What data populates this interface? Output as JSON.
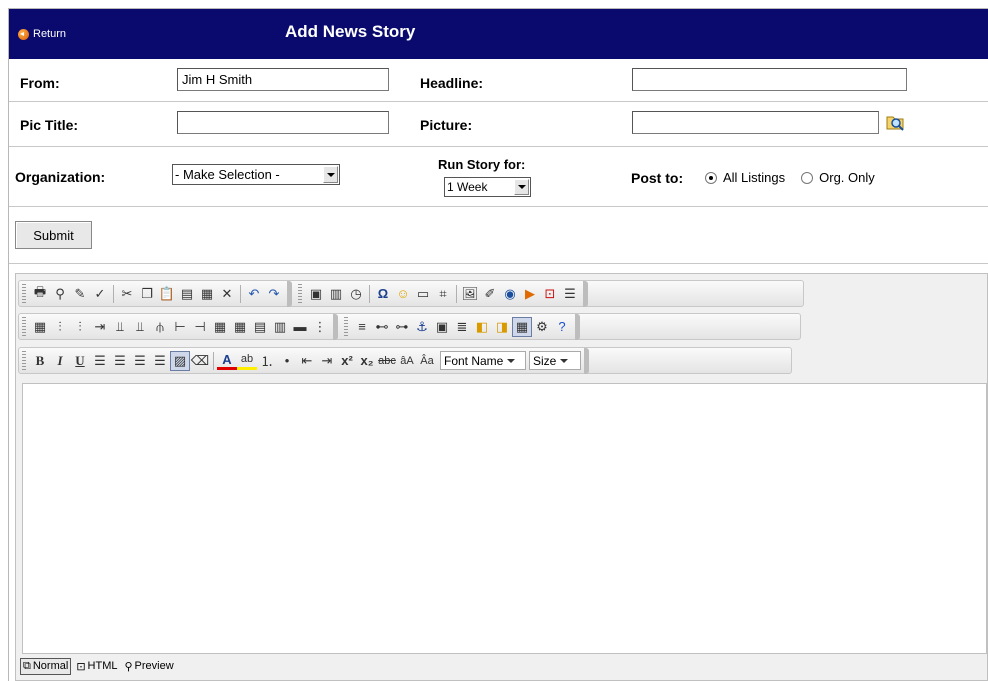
{
  "header": {
    "return_label": "Return",
    "title": "Add News Story",
    "background_color": "#0a0a6e"
  },
  "form": {
    "from_label": "From:",
    "from_value": "Jim H Smith",
    "headline_label": "Headline:",
    "headline_value": "",
    "pic_title_label": "Pic Title:",
    "pic_title_value": "",
    "picture_label": "Picture:",
    "picture_value": "",
    "picture_browse_icon": "folder-search-icon",
    "organization_label": "Organization:",
    "organization_selected": "- Make Selection -",
    "run_story_label": "Run Story for:",
    "run_story_selected": "1 Week",
    "post_to_label": "Post to:",
    "post_to_options": [
      {
        "label": "All Listings",
        "selected": true
      },
      {
        "label": "Org. Only",
        "selected": false
      }
    ],
    "submit_label": "Submit"
  },
  "editor": {
    "toolbar1": [
      "print-icon",
      "find-icon",
      "clean-icon",
      "spellcheck-icon",
      "|",
      "cut-icon",
      "copy-icon",
      "paste-icon",
      "paste-text-icon",
      "paste-word-icon",
      "delete-icon",
      "|",
      "undo-icon",
      "redo-icon",
      "||",
      "insert-template-icon",
      "insert-form-icon",
      "insert-time-icon",
      "|",
      "special-char-icon",
      "emoticon-icon",
      "insert-box-icon",
      "insert-snippet-icon",
      "|",
      "insert-image-icon",
      "image-editor-icon",
      "flash-icon",
      "media-icon",
      "pdf-icon",
      "insert-document-icon"
    ],
    "toolbar2": [
      "insert-table-icon",
      "insert-column-left-icon",
      "insert-column-right-icon",
      "delete-column-icon",
      "insert-row-above-icon",
      "insert-row-below-icon",
      "delete-row-icon",
      "split-cell-icon",
      "merge-cell-icon",
      "table-properties-icon",
      "cell-properties-icon",
      "table-border-icon",
      "table-style-icon",
      "merge-right-icon",
      "merge-down-icon",
      "||",
      "horizontal-rule-icon",
      "insert-link-icon",
      "unlink-icon",
      "anchor-icon",
      "page-properties-icon",
      "paragraph-icon",
      "bring-forward-icon",
      "send-backward-icon",
      "toggle-borders-icon",
      "properties-icon",
      "help-icon"
    ],
    "toolbar3_left": [
      "bold-icon",
      "italic-icon",
      "underline-icon",
      "align-left-icon",
      "align-center-icon",
      "align-right-icon",
      "justify-icon",
      "remove-format-icon",
      "eraser-icon",
      "|",
      "font-color-icon",
      "highlight-icon",
      "ordered-list-icon",
      "unordered-list-icon",
      "outdent-icon",
      "indent-icon",
      "superscript-icon",
      "subscript-icon",
      "strikethrough-icon",
      "font-size-increase-icon",
      "font-size-decrease-icon"
    ],
    "font_name_label": "Font Name",
    "size_label": "Size",
    "modes": [
      {
        "label": "Normal",
        "active": true
      },
      {
        "label": "HTML",
        "active": false
      },
      {
        "label": "Preview",
        "active": false
      }
    ]
  }
}
